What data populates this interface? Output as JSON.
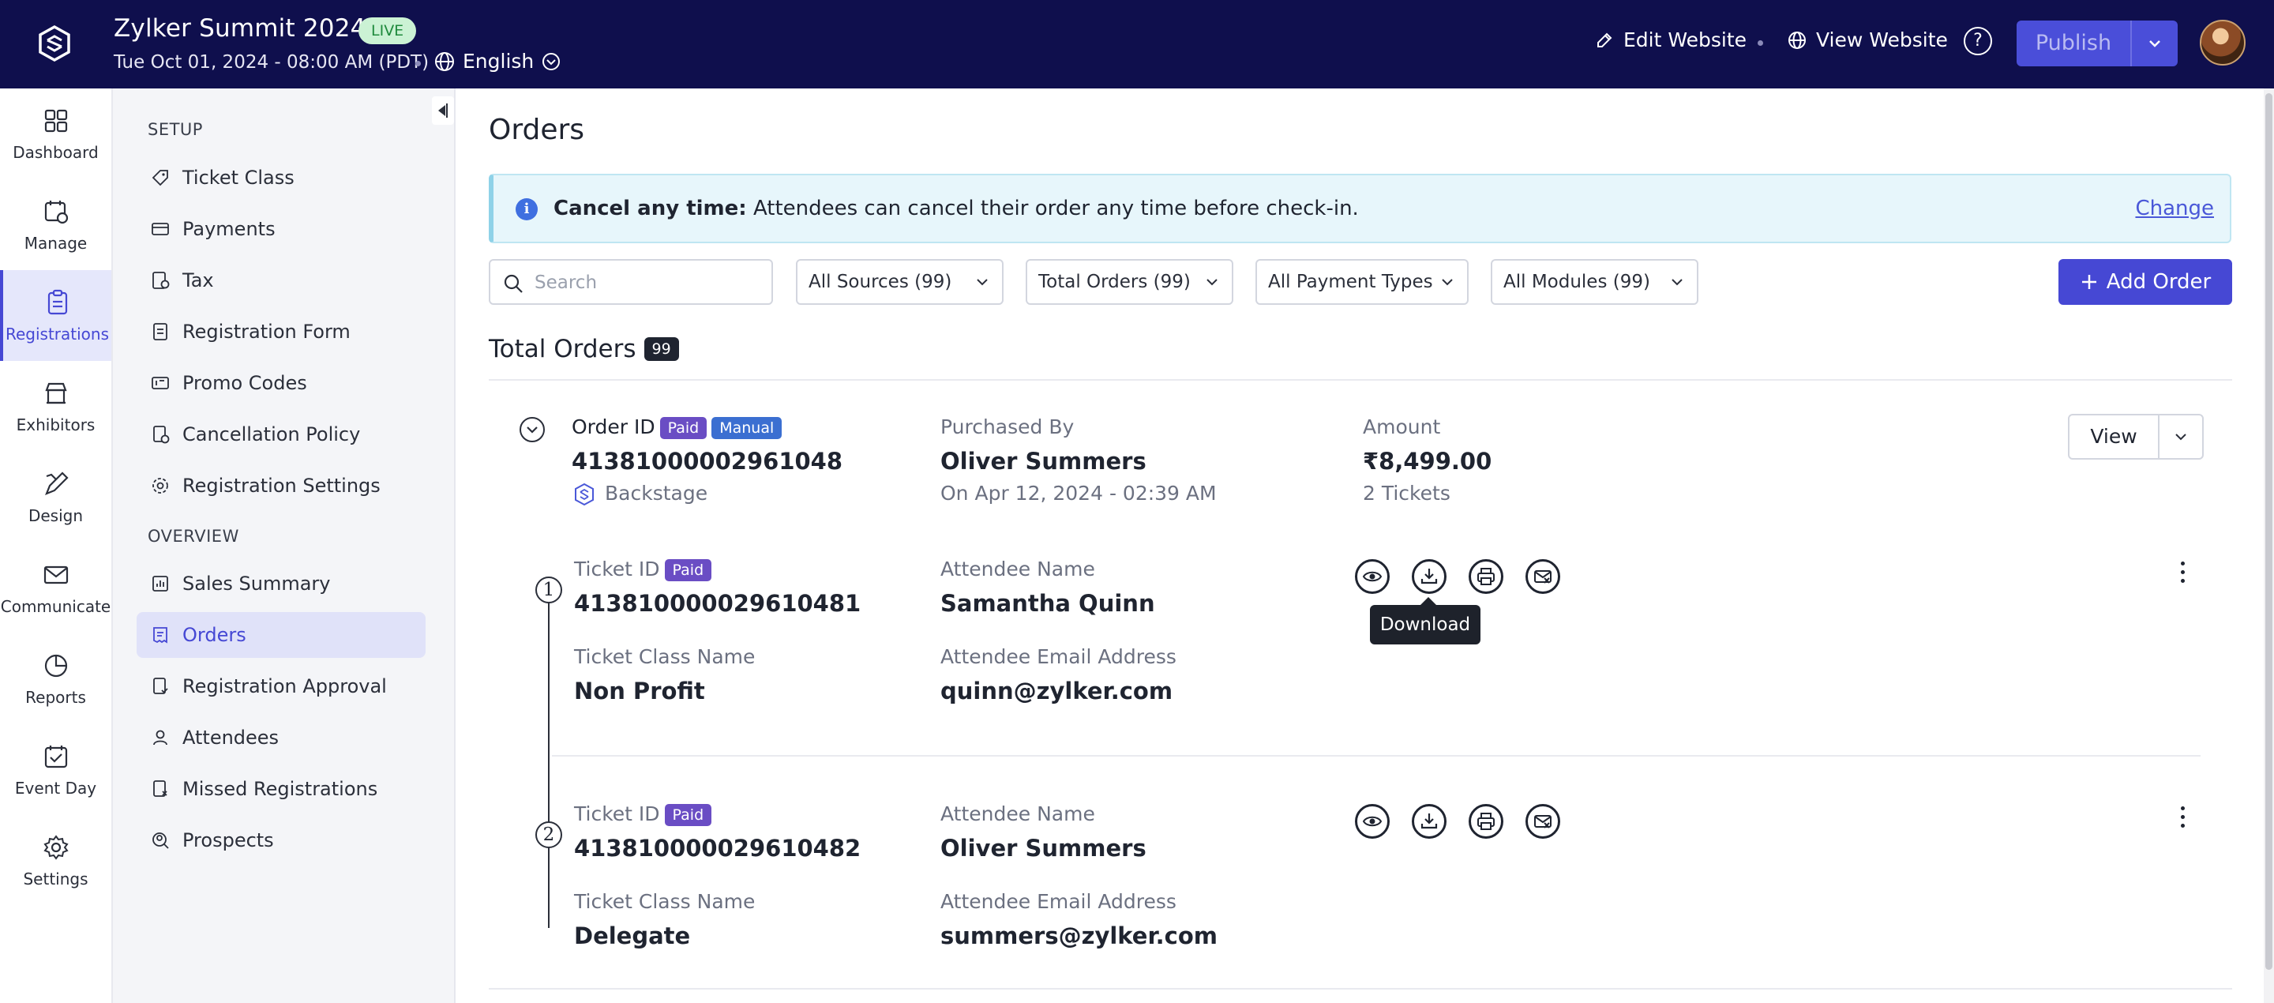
{
  "header": {
    "event_title": "Zylker Summit 2024",
    "live_badge": "LIVE",
    "event_date": "Tue Oct 01, 2024 - 08:00 AM (PDT)",
    "language": "English",
    "edit_website": "Edit Website",
    "view_website": "View Website",
    "publish": "Publish",
    "help_icon": "?"
  },
  "rail": [
    {
      "label": "Dashboard",
      "icon": "dashboard-icon",
      "active": false
    },
    {
      "label": "Manage",
      "icon": "manage-icon",
      "active": false
    },
    {
      "label": "Registrations",
      "icon": "registrations-icon",
      "active": true
    },
    {
      "label": "Exhibitors",
      "icon": "exhibitors-icon",
      "active": false
    },
    {
      "label": "Design",
      "icon": "design-icon",
      "active": false
    },
    {
      "label": "Communicate",
      "icon": "communicate-icon",
      "active": false
    },
    {
      "label": "Reports",
      "icon": "reports-icon",
      "active": false
    },
    {
      "label": "Event Day",
      "icon": "event-day-icon",
      "active": false
    },
    {
      "label": "Settings",
      "icon": "settings-icon",
      "active": false
    }
  ],
  "subnav": {
    "setup_heading": "SETUP",
    "setup_items": [
      {
        "label": "Ticket Class",
        "icon": "ticket-icon"
      },
      {
        "label": "Payments",
        "icon": "card-icon"
      },
      {
        "label": "Tax",
        "icon": "tax-icon"
      },
      {
        "label": "Registration Form",
        "icon": "form-icon"
      },
      {
        "label": "Promo Codes",
        "icon": "promo-icon"
      },
      {
        "label": "Cancellation Policy",
        "icon": "policy-icon"
      },
      {
        "label": "Registration Settings",
        "icon": "gear-icon"
      }
    ],
    "overview_heading": "OVERVIEW",
    "overview_items": [
      {
        "label": "Sales Summary",
        "icon": "summary-icon",
        "active": false
      },
      {
        "label": "Orders",
        "icon": "orders-icon",
        "active": true
      },
      {
        "label": "Registration Approval",
        "icon": "approval-icon",
        "active": false
      },
      {
        "label": "Attendees",
        "icon": "attendees-icon",
        "active": false
      },
      {
        "label": "Missed Registrations",
        "icon": "missed-icon",
        "active": false
      },
      {
        "label": "Prospects",
        "icon": "prospects-icon",
        "active": false
      }
    ]
  },
  "main": {
    "title": "Orders",
    "info": {
      "bold": "Cancel any time:",
      "text": "Attendees can cancel their order any time before check-in.",
      "link": "Change",
      "icon": "i"
    },
    "search_placeholder": "Search",
    "filters": [
      "All Sources (99)",
      "Total Orders (99)",
      "All Payment Types",
      "All Modules (99)"
    ],
    "add_order": "Add Order",
    "total_orders_label": "Total Orders",
    "total_orders_count": "99",
    "order": {
      "id_label": "Order ID",
      "tags": [
        "Paid",
        "Manual"
      ],
      "id": "41381000002961048",
      "source": "Backstage",
      "purchased_by_label": "Purchased By",
      "purchased_by": "Oliver Summers",
      "purchased_on": "On Apr 12, 2024 - 02:39 AM",
      "amount_label": "Amount",
      "amount": "₹8,499.00",
      "tickets": "2 Tickets",
      "view": "View"
    },
    "tickets": [
      {
        "step": "1",
        "id_label": "Ticket ID",
        "tag": "Paid",
        "id": "413810000029610481",
        "class_label": "Ticket Class Name",
        "class": "Non Profit",
        "name_label": "Attendee Name",
        "name": "Samantha Quinn",
        "email_label": "Attendee Email Address",
        "email": "quinn@zylker.com"
      },
      {
        "step": "2",
        "id_label": "Ticket ID",
        "tag": "Paid",
        "id": "413810000029610482",
        "class_label": "Ticket Class Name",
        "class": "Delegate",
        "name_label": "Attendee Name",
        "name": "Oliver Summers",
        "email_label": "Attendee Email Address",
        "email": "summers@zylker.com"
      }
    ],
    "tooltip": "Download"
  }
}
